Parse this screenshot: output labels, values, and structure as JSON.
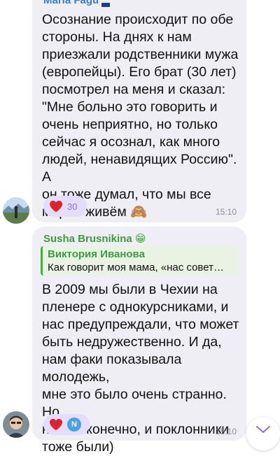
{
  "messages": [
    {
      "sender": "Maria Fagu",
      "text": "Осознание происходит по обе\nстороны. На днях к нам\nприезжали родственники мужа\n(европейцы). Его брат (30 лет)\nпосмотрел на меня и сказал:\n\"Мне больно это говорить и\nочень неприятно, но только\nсейчас я осознал, как много\nлюдей, ненавидящих Россию\". А\nон тоже думал, что мы все\nмирно живём",
      "emoji": "🙈",
      "reaction_count": "30",
      "time": "15:10"
    },
    {
      "sender": "Susha Brusnikina",
      "sender_emoji": "😁",
      "reply_author": "Виктория Иванова",
      "reply_text": "Как говорит моя мама, «нас совет…",
      "text": "В 2009 мы были в Чехии на\nпленере с однокурсниками, и\nнас предупреждали, что может\nбыть недружественно. И да,\nнам факи показывала молодежь,\nмне это было очень странно. Но\nне все конечно, и поклонники\nтоже были)",
      "reactor_initial": "N",
      "time": "15:10"
    }
  ],
  "icons": {
    "heart": "heart-icon",
    "scroll": "chevron-down-icon"
  },
  "colors": {
    "bubble": "#f0eef5",
    "sender1": "#3b7dc4",
    "sender2": "#3f9a3f",
    "reaction_bg": "#e4defa",
    "heart": "#e0242e",
    "reply_bg": "#e8f3e4"
  }
}
